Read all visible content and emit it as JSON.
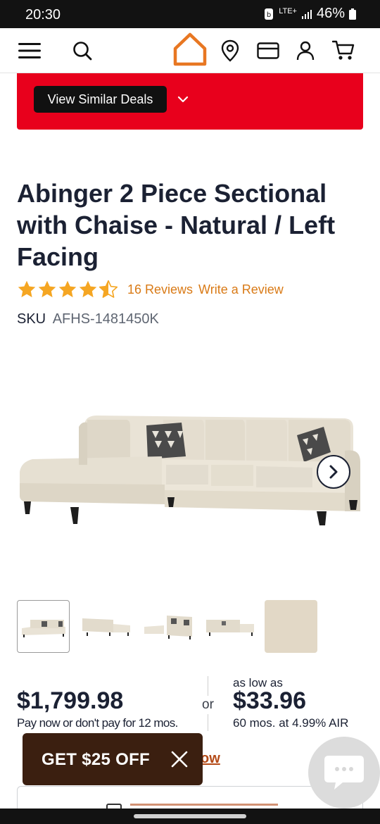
{
  "status": {
    "time": "20:30",
    "network": "LTE+",
    "battery": "46%"
  },
  "header": {
    "icons": [
      "menu-icon",
      "search-icon",
      "logo-house-icon",
      "location-icon",
      "credit-card-icon",
      "account-icon",
      "cart-icon"
    ]
  },
  "deals": {
    "button_label": "View Similar Deals"
  },
  "product": {
    "title": "Abinger 2 Piece Sectional with Chaise - Natural / Left Facing",
    "rating": 4.5,
    "reviews_label": "16 Reviews",
    "write_review_label": "Write a Review",
    "sku_label": "SKU",
    "sku_value": "AFHS-1481450K"
  },
  "pricing": {
    "price": "$1,799.98",
    "pay_note": "Pay now or don't pay for 12 mos.",
    "or_label": "or",
    "as_low_as": "as low as",
    "monthly_price": "$33.96",
    "terms": "60 mos. at 4.99% AIR"
  },
  "promo": {
    "label": "GET $25 OFF",
    "partial_link": "ow"
  },
  "colors": {
    "accent_orange": "#e87722",
    "deals_red": "#e8001c",
    "star_gold": "#f5a623",
    "link_orange": "#d97a16",
    "promo_brown": "#3b1f10"
  }
}
